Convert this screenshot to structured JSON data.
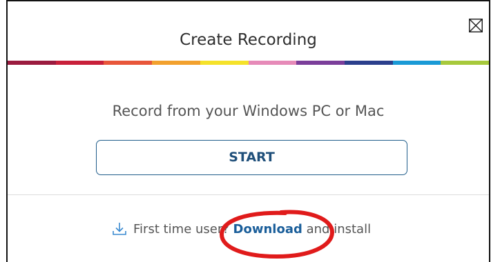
{
  "dialog": {
    "title": "Create Recording",
    "close_icon": "close-box-icon",
    "color_bar": [
      "#9b1b3f",
      "#c8203a",
      "#e8563a",
      "#f2a12e",
      "#f5e22a",
      "#e68ab8",
      "#7b3e9a",
      "#2b3f8c",
      "#1a9ad6",
      "#a7c93c"
    ],
    "subtitle": "Record from your Windows PC or Mac",
    "start_label": "START",
    "download": {
      "icon": "download-icon",
      "prefix": "First time user?",
      "link": "Download",
      "suffix": "and install"
    },
    "annotation_color": "#e01b1b"
  }
}
